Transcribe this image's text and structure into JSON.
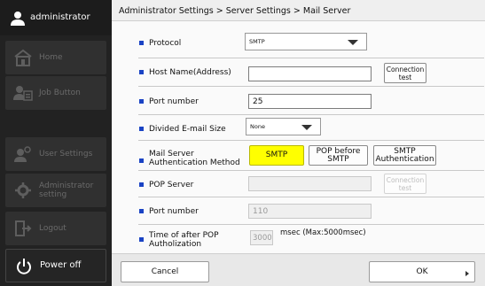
{
  "sidebar": {
    "user": "administrator",
    "items": [
      {
        "label": "Home",
        "icon": "home-icon"
      },
      {
        "label": "Job Button",
        "icon": "job-button-icon"
      },
      {
        "label": "User Settings",
        "icon": "user-settings-icon"
      },
      {
        "label": "Administrator setting",
        "icon": "admin-gear-icon"
      },
      {
        "label": "Logout",
        "icon": "logout-icon"
      }
    ],
    "power_label": "Power off"
  },
  "breadcrumb": "Administrator Settings > Server Settings > Mail Server",
  "form": {
    "protocol": {
      "label": "Protocol",
      "value": "SMTP"
    },
    "host": {
      "label": "Host Name(Address)",
      "value": "",
      "button": "Connection test"
    },
    "port": {
      "label": "Port number",
      "value": "25"
    },
    "divided": {
      "label": "Divided E-mail Size",
      "value": "None"
    },
    "auth": {
      "label": "Mail Server Authentication Method",
      "options": [
        "SMTP",
        "POP before SMTP",
        "SMTP Authentication"
      ],
      "selected": "SMTP"
    },
    "pop_server": {
      "label": "POP Server",
      "value": "",
      "button": "Connection test"
    },
    "pop_port": {
      "label": "Port number",
      "value": "110"
    },
    "pop_time": {
      "label": "Time of after POP Autholization",
      "value": "3000",
      "unit": "msec (Max:5000msec)"
    }
  },
  "footer": {
    "cancel": "Cancel",
    "ok": "OK"
  },
  "colors": {
    "bullet": "#1a43c4",
    "selected": "#ffff00",
    "sidebar": "#222222"
  }
}
